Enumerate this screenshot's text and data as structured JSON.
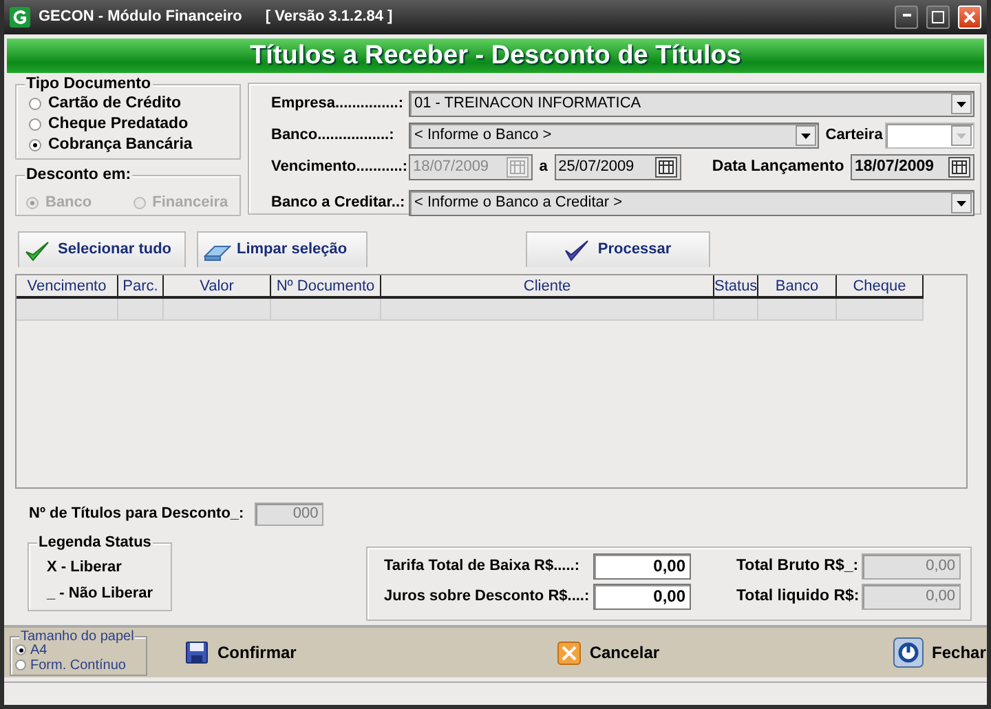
{
  "window": {
    "title": "GECON  -  Módulo Financeiro",
    "version": "[ Versão 3.1.2.84 ]"
  },
  "banner": "Títulos a Receber - Desconto de Títulos",
  "tipo_documento": {
    "title": "Tipo Documento",
    "options": [
      {
        "label": "Cartão de Crédito",
        "selected": false
      },
      {
        "label": "Cheque Predatado",
        "selected": false
      },
      {
        "label": "Cobrança Bancária",
        "selected": true
      }
    ]
  },
  "desconto_em": {
    "title": "Desconto em:",
    "disabled": true,
    "options": [
      {
        "label": "Banco",
        "selected": true
      },
      {
        "label": "Financeira",
        "selected": false
      }
    ]
  },
  "empresa": {
    "label": "Empresa...............:",
    "value": "01 - TREINACON INFORMATICA"
  },
  "banco": {
    "label": "Banco.................:",
    "value": "< Informe o Banco >"
  },
  "carteira": {
    "label": "Carteira",
    "disabled": true
  },
  "vencimento": {
    "label": "Vencimento...........:",
    "from": {
      "value": "18/07/2009",
      "disabled": true
    },
    "separator": "a",
    "to": {
      "value": "25/07/2009",
      "disabled": false
    }
  },
  "data_lancamento": {
    "label": "Data Lançamento",
    "value": "18/07/2009"
  },
  "banco_creditar": {
    "label": "Banco a Creditar..:",
    "value": "< Informe o Banco a Creditar >"
  },
  "actions": [
    {
      "kind": "check",
      "label": "Selecionar tudo"
    },
    {
      "kind": "eraser",
      "label": "Limpar seleção"
    },
    {
      "kind": "process",
      "label": "Processar"
    }
  ],
  "table": {
    "columns": [
      "Vencimento",
      "Parc.",
      "Valor",
      "Nº Documento",
      "Cliente",
      "Status",
      "Banco",
      "Cheque"
    ]
  },
  "count": {
    "label": "Nº de Títulos para Desconto_:",
    "value": "000"
  },
  "legend": {
    "title": "Legenda Status",
    "items": [
      "X - Liberar",
      "_ - Não Liberar"
    ]
  },
  "totals": [
    {
      "label": "Tarifa Total de Baixa R$.....:",
      "value": "0,00",
      "disabled": false
    },
    {
      "label": "Juros sobre Desconto R$....:",
      "value": "0,00",
      "disabled": false
    }
  ],
  "summary": [
    {
      "label": "Total Bruto R$_:",
      "value": "0,00",
      "disabled": true
    },
    {
      "label": "Total liquido R$:",
      "value": "0,00",
      "disabled": true
    }
  ],
  "paper": {
    "title": "Tamanho do papel",
    "options": [
      {
        "label": "A4",
        "selected": true
      },
      {
        "label": "Form. Contínuo",
        "selected": false
      }
    ]
  },
  "footer_buttons": [
    {
      "kind": "save",
      "label": "Confirmar"
    },
    {
      "kind": "cancel",
      "label": "Cancelar"
    },
    {
      "kind": "power",
      "label": "Fechar"
    }
  ]
}
